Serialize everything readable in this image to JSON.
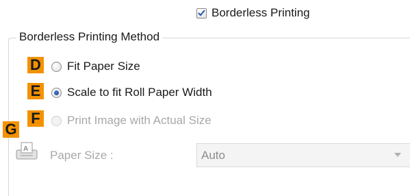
{
  "borderless_checkbox": {
    "label": "Borderless Printing",
    "checked": true
  },
  "group": {
    "legend": "Borderless Printing Method"
  },
  "options": [
    {
      "badge": "D",
      "label": "Fit Paper Size",
      "selected": false,
      "enabled": true
    },
    {
      "badge": "E",
      "label": "Scale to fit Roll Paper Width",
      "selected": true,
      "enabled": true
    },
    {
      "badge": "F",
      "label": "Print Image with Actual Size",
      "selected": false,
      "enabled": false
    }
  ],
  "paper_size": {
    "badge": "G",
    "label": "Paper Size :",
    "value": "Auto",
    "enabled": false,
    "icon": "paper-size-icon"
  },
  "colors": {
    "badge": "#f39200",
    "radio_selected": "#1f4fa8",
    "check": "#2456b3",
    "disabled_text": "#a8a8a8"
  }
}
